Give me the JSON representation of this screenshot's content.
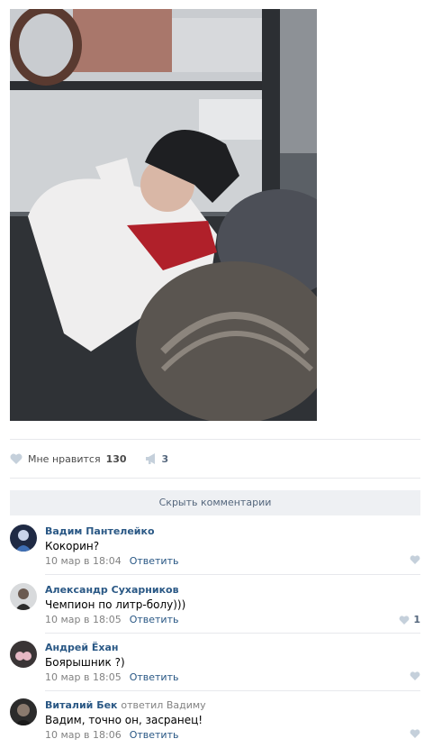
{
  "post": {
    "photo_icon": "photo",
    "likes_label": "Мне нравится",
    "likes_count": "130",
    "shares_count": "3"
  },
  "comments_section": {
    "hide_label": "Скрыть комментарии",
    "reply_label": "Ответить",
    "items": [
      {
        "author": "Вадим Пантелейко",
        "replied_to": "",
        "text": "Кокорин?",
        "time": "10 мар в 18:04",
        "likes": ""
      },
      {
        "author": "Александр Сухарников",
        "replied_to": "",
        "text": "Чемпион по литр-болу)))",
        "time": "10 мар в 18:05",
        "likes": "1"
      },
      {
        "author": "Андрей Ёхан",
        "replied_to": "",
        "text": "Боярышник ?)",
        "time": "10 мар в 18:05",
        "likes": ""
      },
      {
        "author": "Виталий Бек",
        "replied_to": "ответил Вадиму",
        "text": "Вадим, точно он, засранец!",
        "time": "10 мар в 18:06",
        "likes": ""
      }
    ]
  },
  "colors": {
    "link": "#2a5885",
    "meta": "#828282",
    "button_bg": "#eef0f3",
    "heart": "#c5d0db"
  }
}
